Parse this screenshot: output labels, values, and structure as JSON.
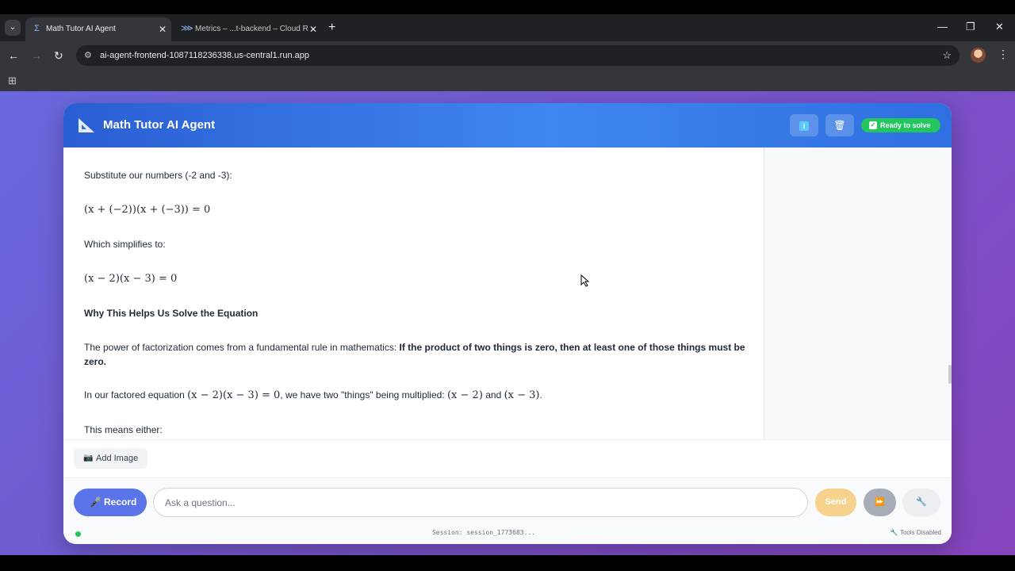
{
  "browser": {
    "tabs": [
      {
        "title": "Math Tutor AI Agent",
        "favicon": "sigma-icon",
        "active": true
      },
      {
        "title": "Metrics – ...t-backend – Cloud R",
        "favicon": "cloud-run-icon",
        "active": false
      }
    ],
    "url": "ai-agent-frontend-1087118236338.us-central1.run.app"
  },
  "header": {
    "title": "Math Tutor AI Agent",
    "status": "Ready to solve"
  },
  "chat": {
    "line1": "Substitute our numbers (-2 and -3):",
    "eq1": "(x + (−2))(x + (−3)) = 0",
    "line2": "Which simplifies to:",
    "eq2": "(x − 2)(x − 3) = 0",
    "heading": "Why This Helps Us Solve the Equation",
    "para1_prefix": "The power of factorization comes from a fundamental rule in mathematics: ",
    "para1_bold": "If the product of two things is zero, then at least one of those things must be zero.",
    "para2_prefix": "In our factored equation ",
    "para2_eq": "(x − 2)(x − 3) = 0",
    "para2_mid": ", we have two \"things\" being multiplied: ",
    "para2_f1": "(x − 2)",
    "para2_and": " and ",
    "para2_f2": "(x − 3)",
    "para2_end": ".",
    "line3": "This means either:"
  },
  "input": {
    "add_image": "Add Image",
    "record": "Record",
    "placeholder": "Ask a question...",
    "send": "Send"
  },
  "footer": {
    "session": "Session: session_1773683...",
    "tools": "Tools Disabled"
  },
  "colors": {
    "accent": "#3f86f0",
    "status": "#22c55e",
    "record": "#5b74ea",
    "send": "#f6d28c"
  }
}
